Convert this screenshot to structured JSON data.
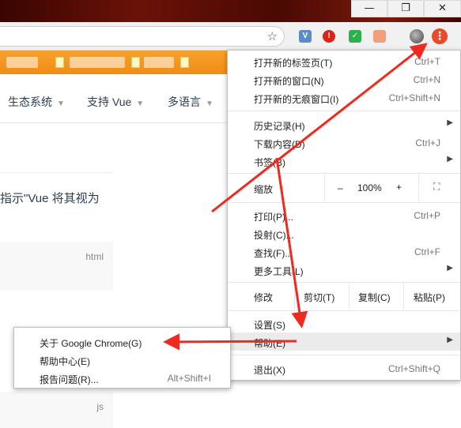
{
  "window": {
    "minimize_glyph": "—",
    "restore_glyph": "❐",
    "close_glyph": "✕"
  },
  "toolbar": {
    "star_icon": "star-icon",
    "kebab_glyph": "⋮"
  },
  "page": {
    "nav_items": [
      "生态系统",
      "支持 Vue",
      "多语言"
    ],
    "caret": "▼",
    "content_text": "指示\"Vue 将其视为",
    "code_lang_1": "html",
    "code_lang_2": "js"
  },
  "menu": {
    "new_tab": {
      "label": "打开新的标签页(T)",
      "shortcut": "Ctrl+T"
    },
    "new_window": {
      "label": "打开新的窗口(N)",
      "shortcut": "Ctrl+N"
    },
    "incognito": {
      "label": "打开新的无痕窗口(I)",
      "shortcut": "Ctrl+Shift+N"
    },
    "history": {
      "label": "历史记录(H)"
    },
    "downloads": {
      "label": "下载内容(D)",
      "shortcut": "Ctrl+J"
    },
    "bookmarks": {
      "label": "书签(B)"
    },
    "zoom": {
      "label": "缩放",
      "minus": "–",
      "value": "100%",
      "plus": "+"
    },
    "print": {
      "label": "打印(P)...",
      "shortcut": "Ctrl+P"
    },
    "cast": {
      "label": "投射(C)..."
    },
    "find": {
      "label": "查找(F)...",
      "shortcut": "Ctrl+F"
    },
    "more_tools": {
      "label": "更多工具(L)"
    },
    "edit": {
      "label": "修改",
      "cut": "剪切(T)",
      "copy": "复制(C)",
      "paste": "粘贴(P)"
    },
    "settings": {
      "label": "设置(S)"
    },
    "help": {
      "label": "帮助(E)"
    },
    "exit": {
      "label": "退出(X)",
      "shortcut": "Ctrl+Shift+Q"
    },
    "submenu_arrow": "▶"
  },
  "submenu": {
    "about": {
      "label": "关于 Google Chrome(G)"
    },
    "help_center": {
      "label": "帮助中心(E)"
    },
    "report": {
      "label": "报告问题(R)...",
      "shortcut": "Alt+Shift+I"
    }
  },
  "colors": {
    "annotation_red": "#f02a1e",
    "bookmark_bar": "#f39519",
    "highlight": "#ebebeb"
  }
}
